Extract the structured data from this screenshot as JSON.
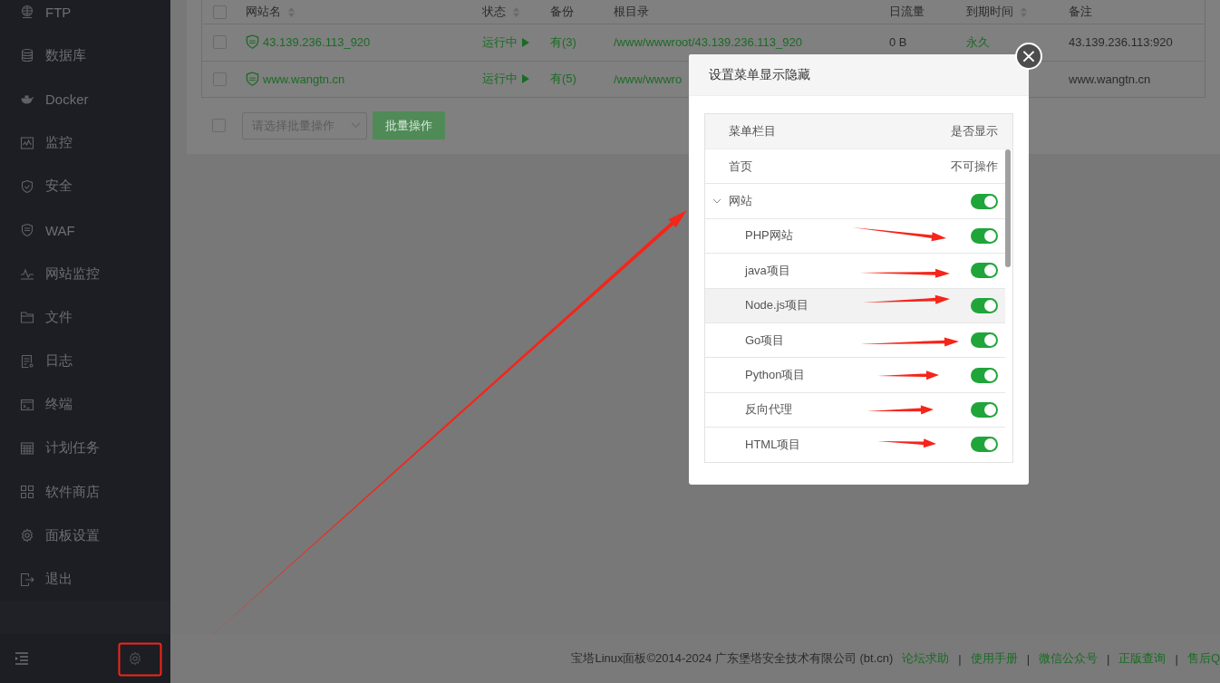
{
  "sidebar": {
    "items": [
      {
        "label": "FTP"
      },
      {
        "label": "数据库"
      },
      {
        "label": "Docker"
      },
      {
        "label": "监控"
      },
      {
        "label": "安全"
      },
      {
        "label": "WAF"
      },
      {
        "label": "网站监控"
      },
      {
        "label": "文件"
      },
      {
        "label": "日志"
      },
      {
        "label": "终端"
      },
      {
        "label": "计划任务"
      },
      {
        "label": "软件商店"
      },
      {
        "label": "面板设置"
      },
      {
        "label": "退出"
      }
    ]
  },
  "table": {
    "header_checked": false,
    "columns": [
      {
        "label": "网站名",
        "sortable": true
      },
      {
        "label": "状态",
        "sortable": true
      },
      {
        "label": "备份",
        "sortable": false
      },
      {
        "label": "根目录",
        "sortable": false
      },
      {
        "label": "日流量",
        "sortable": false
      },
      {
        "label": "到期时间",
        "sortable": true
      },
      {
        "label": "备注",
        "sortable": false
      }
    ],
    "rows": [
      {
        "checked": false,
        "name": "43.139.236.113_920",
        "status": "运行中",
        "backup": "有(3)",
        "root": "/www/wwwroot/43.139.236.113_920",
        "traffic": "0 B",
        "expiry": "永久",
        "remark": "43.139.236.113:920"
      },
      {
        "checked": false,
        "name": "www.wangtn.cn",
        "status": "运行中",
        "backup": "有(5)",
        "root": "/www/wwwro",
        "remark": "www.wangtn.cn"
      }
    ]
  },
  "batch": {
    "select_all_checked": false,
    "placeholder": "请选择批量操作",
    "button": "批量操作"
  },
  "dialog": {
    "title": "设置菜单显示隐藏",
    "close": "×",
    "columns": [
      "菜单栏目",
      "是否显示"
    ],
    "items": [
      {
        "label": "首页",
        "kind": "fixed",
        "note": "不可操作"
      },
      {
        "label": "网站",
        "kind": "toggle",
        "on": true,
        "expanded": true,
        "children": [
          {
            "label": "PHP网站",
            "kind": "toggle",
            "on": true,
            "highlighted": false
          },
          {
            "label": "java项目",
            "kind": "toggle",
            "on": true,
            "highlighted": false
          },
          {
            "label": "Node.js项目",
            "kind": "toggle",
            "on": true,
            "highlighted": true
          },
          {
            "label": "Go项目",
            "kind": "toggle",
            "on": true,
            "highlighted": false
          },
          {
            "label": "Python项目",
            "kind": "toggle",
            "on": true,
            "highlighted": false
          },
          {
            "label": "反向代理",
            "kind": "toggle",
            "on": true,
            "highlighted": false
          },
          {
            "label": "HTML项目",
            "kind": "toggle",
            "on": true,
            "highlighted": false
          }
        ]
      }
    ]
  },
  "footer": {
    "copyright": "宝塔Linux面板©2014-2024 广东堡塔安全技术有限公司 (bt.cn)",
    "items": [
      {
        "kind": "link",
        "text": "论坛求助"
      },
      {
        "kind": "separator",
        "text": "|"
      },
      {
        "kind": "link",
        "text": "使用手册"
      },
      {
        "kind": "separator",
        "text": "|"
      },
      {
        "kind": "link",
        "text": "微信公众号"
      },
      {
        "kind": "separator",
        "text": "|"
      },
      {
        "kind": "link",
        "text": "正版查询"
      },
      {
        "kind": "separator",
        "text": "|"
      },
      {
        "kind": "link",
        "text": "售后Q"
      }
    ]
  }
}
